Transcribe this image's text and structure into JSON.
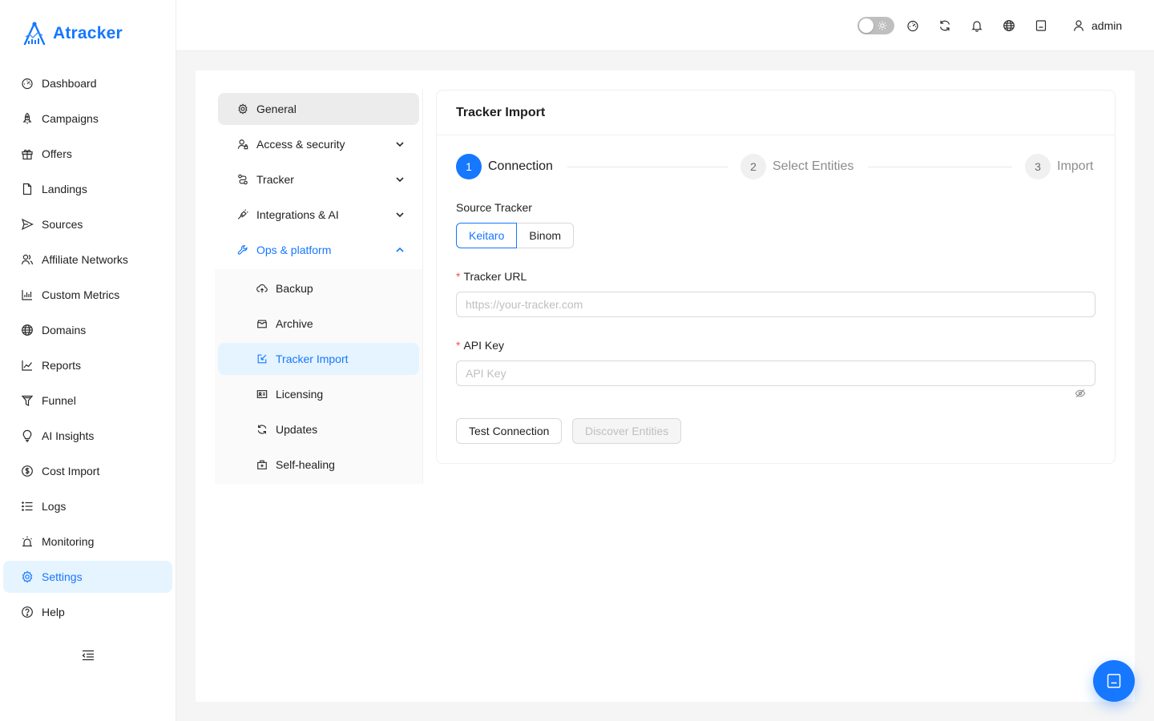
{
  "app": {
    "name": "Atracker"
  },
  "colors": {
    "accent": "#1677ff",
    "required": "#ff4d4f"
  },
  "sidebar": {
    "items": [
      {
        "label": "Dashboard",
        "icon": "dashboard-icon"
      },
      {
        "label": "Campaigns",
        "icon": "rocket-icon"
      },
      {
        "label": "Offers",
        "icon": "gift-icon"
      },
      {
        "label": "Landings",
        "icon": "file-icon"
      },
      {
        "label": "Sources",
        "icon": "send-icon"
      },
      {
        "label": "Affiliate Networks",
        "icon": "team-icon"
      },
      {
        "label": "Custom Metrics",
        "icon": "bar-chart-icon"
      },
      {
        "label": "Domains",
        "icon": "globe-icon"
      },
      {
        "label": "Reports",
        "icon": "line-chart-icon"
      },
      {
        "label": "Funnel",
        "icon": "funnel-icon"
      },
      {
        "label": "AI Insights",
        "icon": "bulb-icon"
      },
      {
        "label": "Cost Import",
        "icon": "dollar-icon"
      },
      {
        "label": "Logs",
        "icon": "list-icon"
      },
      {
        "label": "Monitoring",
        "icon": "alert-icon"
      },
      {
        "label": "Settings",
        "icon": "gear-icon",
        "active": true
      },
      {
        "label": "Help",
        "icon": "question-icon"
      }
    ]
  },
  "header": {
    "icons": [
      "dashboard-icon",
      "sync-icon",
      "bell-icon",
      "globe-icon",
      "robot-icon"
    ],
    "user": "admin"
  },
  "settings_menu": {
    "general": "General",
    "access": "Access & security",
    "tracker": "Tracker",
    "integrations": "Integrations & AI",
    "ops": "Ops & platform",
    "sub": {
      "backup": "Backup",
      "archive": "Archive",
      "tracker_import": "Tracker Import",
      "licensing": "Licensing",
      "updates": "Updates",
      "self_healing": "Self-healing"
    }
  },
  "panel": {
    "title": "Tracker Import",
    "steps": [
      {
        "num": "1",
        "title": "Connection"
      },
      {
        "num": "2",
        "title": "Select Entities"
      },
      {
        "num": "3",
        "title": "Import"
      }
    ],
    "current_step": 1,
    "source_label": "Source Tracker",
    "source_options": [
      "Keitaro",
      "Binom"
    ],
    "source_selected": "Keitaro",
    "required_mark": "*",
    "url_label": "Tracker URL",
    "url_placeholder": "https://your-tracker.com",
    "url_value": "",
    "api_label": "API Key",
    "api_placeholder": "API Key",
    "api_value": "",
    "test_button": "Test Connection",
    "discover_button": "Discover Entities"
  }
}
